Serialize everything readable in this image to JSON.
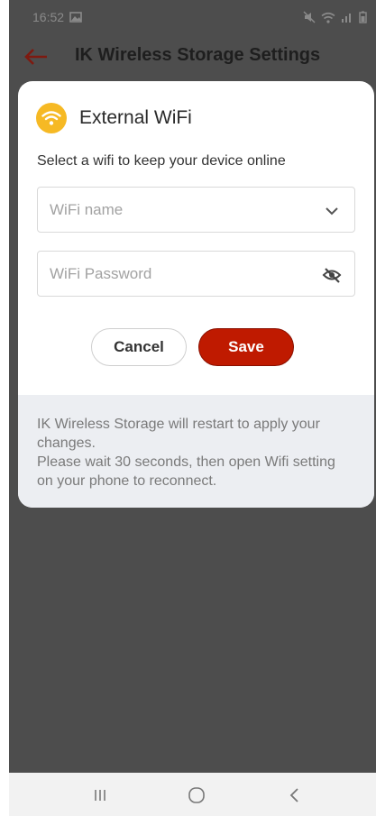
{
  "status_bar": {
    "time": "16:52"
  },
  "app_bar": {
    "title": "IK Wireless Storage Settings",
    "back_icon": "back-arrow-icon"
  },
  "dialog": {
    "icon": "wifi-icon",
    "title": "External WiFi",
    "subtitle": "Select a wifi to keep your device online",
    "wifi_name": {
      "placeholder": "WiFi name",
      "icon": "chevron-down-icon"
    },
    "wifi_password": {
      "placeholder": "WiFi Password",
      "icon": "eye-off-icon"
    },
    "cancel_label": "Cancel",
    "save_label": "Save",
    "info_lines": [
      "IK Wireless Storage will restart to apply your",
      "changes.",
      "Please wait 30 seconds, then open Wifi setting",
      "on your phone to reconnect."
    ]
  },
  "nav_bar": {
    "icons": [
      "recent-apps-icon",
      "home-icon",
      "back-icon"
    ]
  },
  "colors": {
    "accent": "#bf1a00",
    "wifi_badge": "#f6b924",
    "backdrop": "#4d4d4d",
    "info_panel": "#eceef2"
  }
}
